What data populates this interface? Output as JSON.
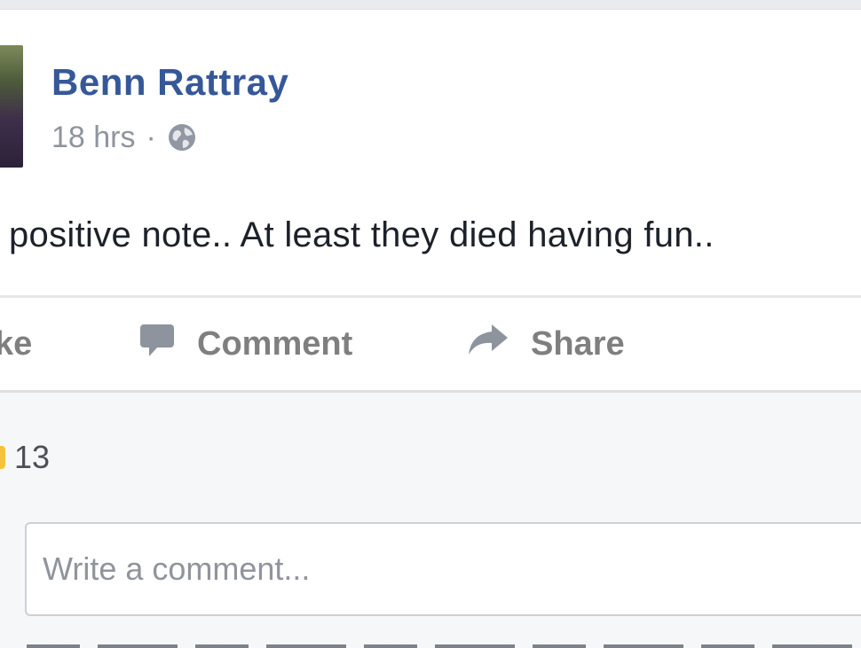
{
  "post": {
    "author": "Benn Rattray",
    "time": "18 hrs",
    "separator": "·",
    "privacy_icon": "globe-icon",
    "text": "positive note.. At least they died having fun..",
    "actions": {
      "like_label": "ke",
      "comment_label": "Comment",
      "share_label": "Share"
    },
    "reaction_count": "13",
    "comment_input": {
      "placeholder": "Write a comment..."
    }
  },
  "colors": {
    "author": "#365899",
    "meta": "#90949c",
    "action": "#7f7f7f",
    "text": "#1d2129"
  }
}
